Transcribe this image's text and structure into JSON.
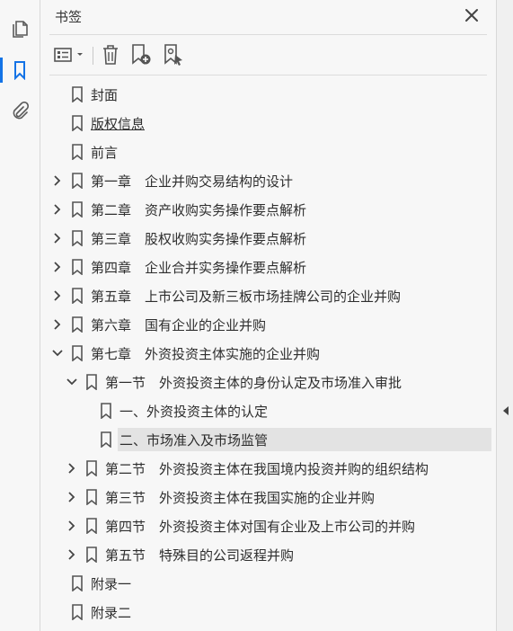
{
  "left_rail": {
    "items": [
      {
        "name": "pages-icon"
      },
      {
        "name": "bookmark-icon",
        "active": true
      },
      {
        "name": "attachment-icon"
      }
    ]
  },
  "panel": {
    "title": "书签",
    "toolbar": [
      "options-menu-icon",
      "delete-icon",
      "new-bookmark-icon",
      "new-bookmark-from-structure-icon"
    ]
  },
  "bookmarks": [
    {
      "level": 0,
      "label": "封面",
      "expand": "none"
    },
    {
      "level": 0,
      "label": "版权信息",
      "expand": "none",
      "underline": true
    },
    {
      "level": 0,
      "label": "前言",
      "expand": "none"
    },
    {
      "level": 0,
      "label": "第一章　企业并购交易结构的设计",
      "expand": "collapsed"
    },
    {
      "level": 0,
      "label": "第二章　资产收购实务操作要点解析",
      "expand": "collapsed"
    },
    {
      "level": 0,
      "label": "第三章　股权收购实务操作要点解析",
      "expand": "collapsed"
    },
    {
      "level": 0,
      "label": "第四章　企业合并实务操作要点解析",
      "expand": "collapsed"
    },
    {
      "level": 0,
      "label": "第五章　上市公司及新三板市场挂牌公司的企业并购",
      "expand": "collapsed"
    },
    {
      "level": 0,
      "label": "第六章　国有企业的企业并购",
      "expand": "collapsed"
    },
    {
      "level": 0,
      "label": "第七章　外资投资主体实施的企业并购",
      "expand": "expanded"
    },
    {
      "level": 1,
      "label": "第一节　外资投资主体的身份认定及市场准入审批",
      "expand": "expanded"
    },
    {
      "level": 2,
      "label": "一、外资投资主体的认定",
      "expand": "none"
    },
    {
      "level": 2,
      "label": "二、市场准入及市场监管",
      "expand": "none",
      "selected": true
    },
    {
      "level": 1,
      "label": "第二节　外资投资主体在我国境内投资并购的组织结构",
      "expand": "collapsed"
    },
    {
      "level": 1,
      "label": "第三节　外资投资主体在我国实施的企业并购",
      "expand": "collapsed"
    },
    {
      "level": 1,
      "label": "第四节　外资投资主体对国有企业及上市公司的并购",
      "expand": "collapsed"
    },
    {
      "level": 1,
      "label": "第五节　特殊目的公司返程并购",
      "expand": "collapsed"
    },
    {
      "level": 0,
      "label": "附录一",
      "expand": "none"
    },
    {
      "level": 0,
      "label": "附录二",
      "expand": "none"
    }
  ],
  "colors": {
    "accent": "#1473e6",
    "icon": "#5a5a5a",
    "selected_bg": "#e3e3e3"
  }
}
